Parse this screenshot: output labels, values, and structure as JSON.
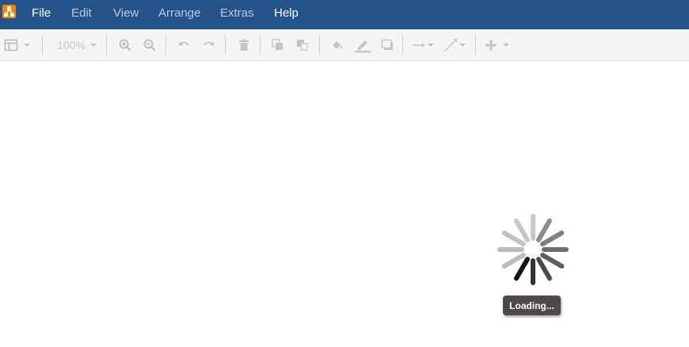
{
  "app": {
    "logo_icon": "drawio-logo-icon",
    "brand_color": "#f08705",
    "menubar_color": "#24528a"
  },
  "menu": [
    {
      "label": "File",
      "active": true
    },
    {
      "label": "Edit",
      "active": false
    },
    {
      "label": "View",
      "active": false
    },
    {
      "label": "Arrange",
      "active": false
    },
    {
      "label": "Extras",
      "active": false
    },
    {
      "label": "Help",
      "active": true
    }
  ],
  "toolbar": {
    "zoom": "100%",
    "icons": [
      "panel-layout-icon",
      "zoom-in-icon",
      "zoom-out-icon",
      "undo-icon",
      "redo-icon",
      "delete-icon",
      "to-front-icon",
      "to-back-icon",
      "fill-color-icon",
      "line-color-icon",
      "shadow-icon",
      "connection-icon",
      "waypoints-icon",
      "insert-icon"
    ]
  },
  "status": {
    "loading_label": "Loading..."
  }
}
